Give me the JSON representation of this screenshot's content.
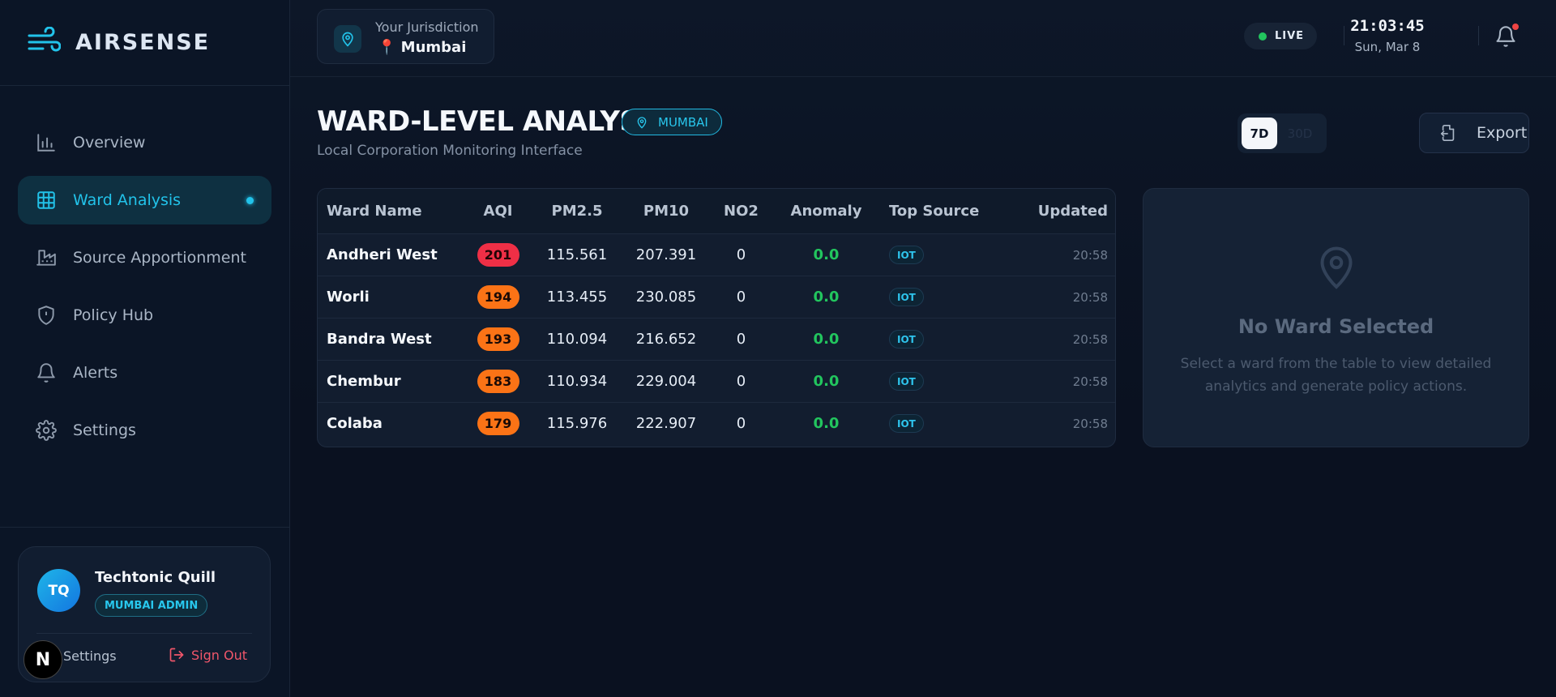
{
  "brand": {
    "name": "AIRSENSE"
  },
  "nav": {
    "items": [
      {
        "label": "Overview",
        "icon": "bar-chart-icon"
      },
      {
        "label": "Ward Analysis",
        "icon": "grid-icon",
        "active": true
      },
      {
        "label": "Source Apportionment",
        "icon": "factory-icon"
      },
      {
        "label": "Policy Hub",
        "icon": "shield-icon"
      },
      {
        "label": "Alerts",
        "icon": "bell-icon"
      },
      {
        "label": "Settings",
        "icon": "gear-icon"
      }
    ]
  },
  "user": {
    "initials": "TQ",
    "name": "Techtonic Quill",
    "role": "MUMBAI ADMIN",
    "settings_label": "Settings",
    "signout_label": "Sign Out",
    "badge": "N"
  },
  "topbar": {
    "jurisdiction_label": "Your Jurisdiction",
    "jurisdiction_city": "📍 Mumbai",
    "live_label": "LIVE",
    "time": "21:03:45",
    "date": "Sun, Mar 8"
  },
  "page": {
    "title": "WARD-LEVEL ANALYSIS",
    "city_badge": "MUMBAI",
    "subtitle": "Local Corporation Monitoring Interface",
    "range_options": [
      "7D",
      "30D"
    ],
    "range_selected": "7D",
    "export_label": "Export"
  },
  "table": {
    "columns": [
      "Ward Name",
      "AQI",
      "PM2.5",
      "PM10",
      "NO2",
      "Anomaly",
      "Top Source",
      "Updated"
    ],
    "rows": [
      {
        "ward": "Andheri West",
        "aqi": "201",
        "pm25": "115.561",
        "pm10": "207.391",
        "no2": "0",
        "anomaly": "0.0",
        "source": "IOT",
        "updated": "20:58"
      },
      {
        "ward": "Worli",
        "aqi": "194",
        "pm25": "113.455",
        "pm10": "230.085",
        "no2": "0",
        "anomaly": "0.0",
        "source": "IOT",
        "updated": "20:58"
      },
      {
        "ward": "Bandra West",
        "aqi": "193",
        "pm25": "110.094",
        "pm10": "216.652",
        "no2": "0",
        "anomaly": "0.0",
        "source": "IOT",
        "updated": "20:58"
      },
      {
        "ward": "Chembur",
        "aqi": "183",
        "pm25": "110.934",
        "pm10": "229.004",
        "no2": "0",
        "anomaly": "0.0",
        "source": "IOT",
        "updated": "20:58"
      },
      {
        "ward": "Colaba",
        "aqi": "179",
        "pm25": "115.976",
        "pm10": "222.907",
        "no2": "0",
        "anomaly": "0.0",
        "source": "IOT",
        "updated": "20:58"
      }
    ]
  },
  "detail": {
    "title": "No Ward Selected",
    "text": "Select a ward from the table to view detailed analytics and generate policy actions."
  },
  "colors": {
    "accent": "#22c3ea",
    "aqi_red": "#ef2f46",
    "aqi_orange": "#fb7316",
    "anomaly_green": "#22c55e",
    "signout_red": "#f0566a"
  }
}
